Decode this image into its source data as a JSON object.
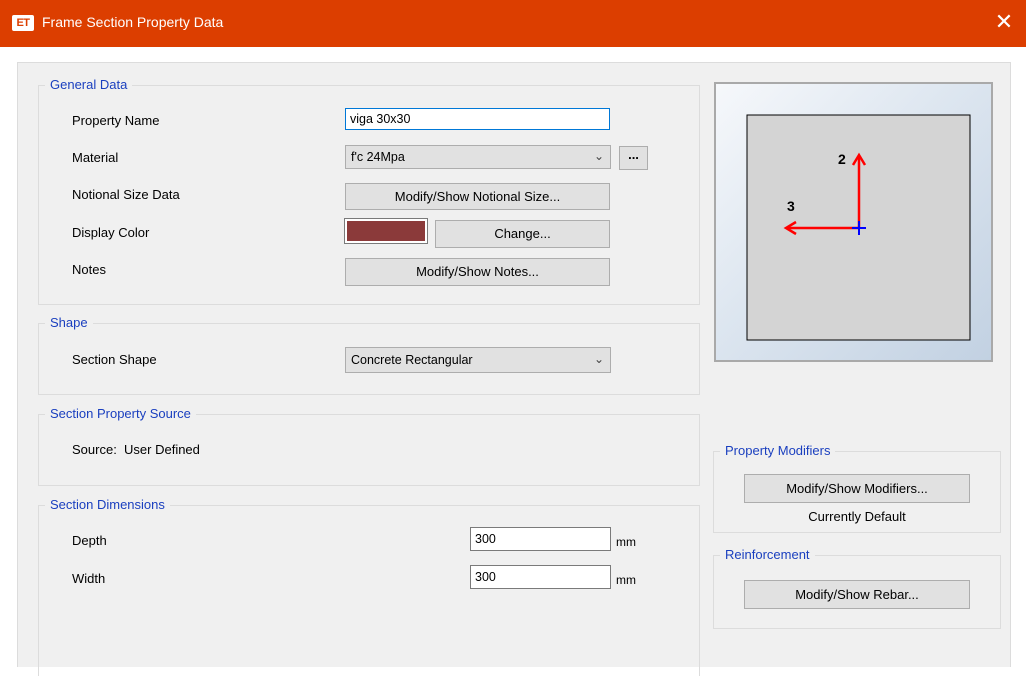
{
  "window": {
    "app_badge": "ET",
    "title": "Frame Section Property Data",
    "close_glyph": "✕"
  },
  "general_data": {
    "title": "General Data",
    "property_name_label": "Property Name",
    "property_name_value": "viga 30x30",
    "material_label": "Material",
    "material_value": "f'c 24Mpa",
    "material_more": "...",
    "notional_label": "Notional Size Data",
    "notional_button": "Modify/Show Notional Size...",
    "display_color_label": "Display Color",
    "display_color": "#8b3a3a",
    "change_button": "Change...",
    "notes_label": "Notes",
    "notes_button": "Modify/Show Notes..."
  },
  "shape": {
    "title": "Shape",
    "section_shape_label": "Section Shape",
    "section_shape_value": "Concrete Rectangular"
  },
  "source": {
    "title": "Section Property Source",
    "source_text": "Source:  User Defined"
  },
  "dimensions": {
    "title": "Section Dimensions",
    "depth_label": "Depth",
    "depth_value": "300",
    "depth_unit": "mm",
    "width_label": "Width",
    "width_value": "300",
    "width_unit": "mm"
  },
  "preview": {
    "axis2_label": "2",
    "axis3_label": "3",
    "axis_color": "#ff0000",
    "centroid_color": "#0000ff"
  },
  "modifiers": {
    "title": "Property Modifiers",
    "button": "Modify/Show Modifiers...",
    "status": "Currently Default"
  },
  "reinforcement": {
    "title": "Reinforcement",
    "button": "Modify/Show Rebar..."
  }
}
